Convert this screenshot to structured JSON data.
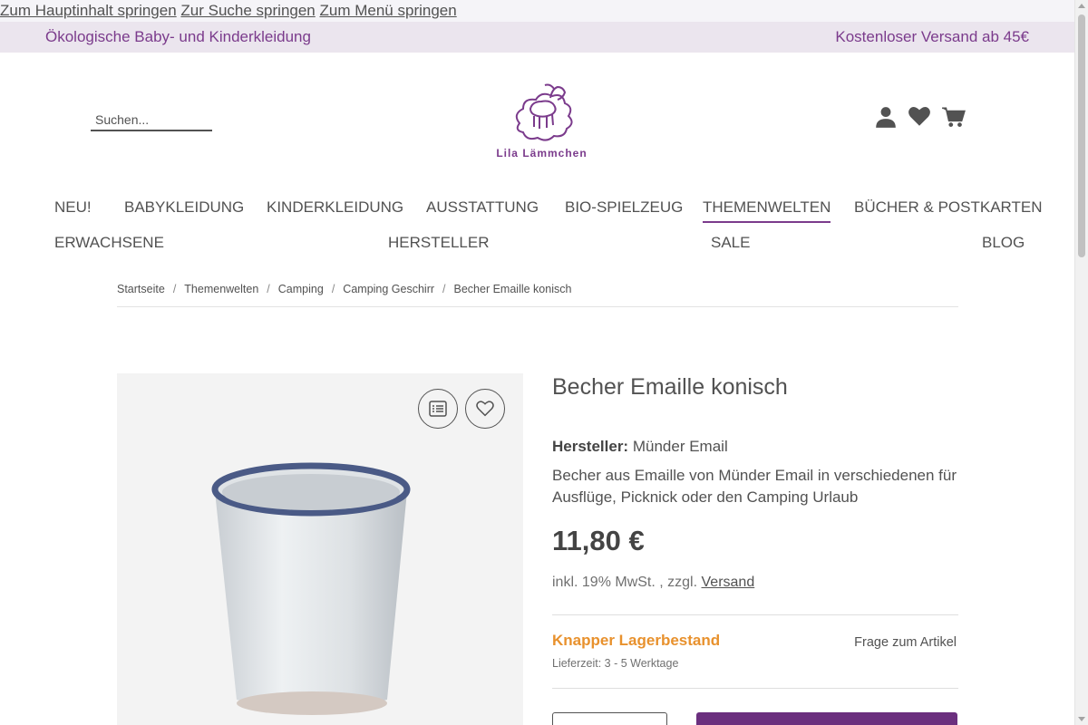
{
  "skip_links": [
    "Zum Hauptinhalt springen",
    "Zur Suche springen",
    "Zum Menü springen"
  ],
  "topbar": {
    "left": "Ökologische Baby- und Kinderkleidung",
    "right": "Kostenloser Versand ab 45€"
  },
  "search": {
    "placeholder": "Suchen..."
  },
  "logo": {
    "text": "Lila Lämmchen"
  },
  "header_icons": [
    "user-icon",
    "heart-icon",
    "cart-icon"
  ],
  "nav": {
    "row1": [
      "NEU!",
      "BABYKLEIDUNG",
      "KINDERKLEIDUNG",
      "AUSSTATTUNG",
      "BIO-SPIELZEUG",
      "THEMENWELTEN",
      "BÜCHER & POSTKARTEN"
    ],
    "row2": [
      "ERWACHSENE",
      "HERSTELLER",
      "SALE",
      "BLOG"
    ],
    "active": "THEMENWELTEN"
  },
  "breadcrumb": [
    "Startseite",
    "Themenwelten",
    "Camping",
    "Camping Geschirr",
    "Becher Emaille konisch"
  ],
  "breadcrumb_separator": "/",
  "gallery": {
    "buttons": [
      "compare-list-icon",
      "wishlist-heart-icon"
    ]
  },
  "product": {
    "title": "Becher Emaille konisch",
    "manufacturer_label": "Hersteller:",
    "manufacturer": "Münder Email",
    "description": "Becher aus Emaille von Münder Email in verschiedenen für Ausflüge, Picknick oder den Camping Urlaub",
    "price": "11,80 €",
    "tax_text": "inkl. 19% MwSt. , zzgl.",
    "shipping_link": "Versand",
    "stock": "Knapper Lagerbestand",
    "delivery": "Lieferzeit: 3 - 5 Werktage",
    "question_link": "Frage zum Artikel"
  },
  "colors": {
    "brand": "#7b3b8c",
    "stock_warning": "#e8912d",
    "cart_button": "#6b2f7e",
    "topbar_bg": "#ebe5ee"
  }
}
